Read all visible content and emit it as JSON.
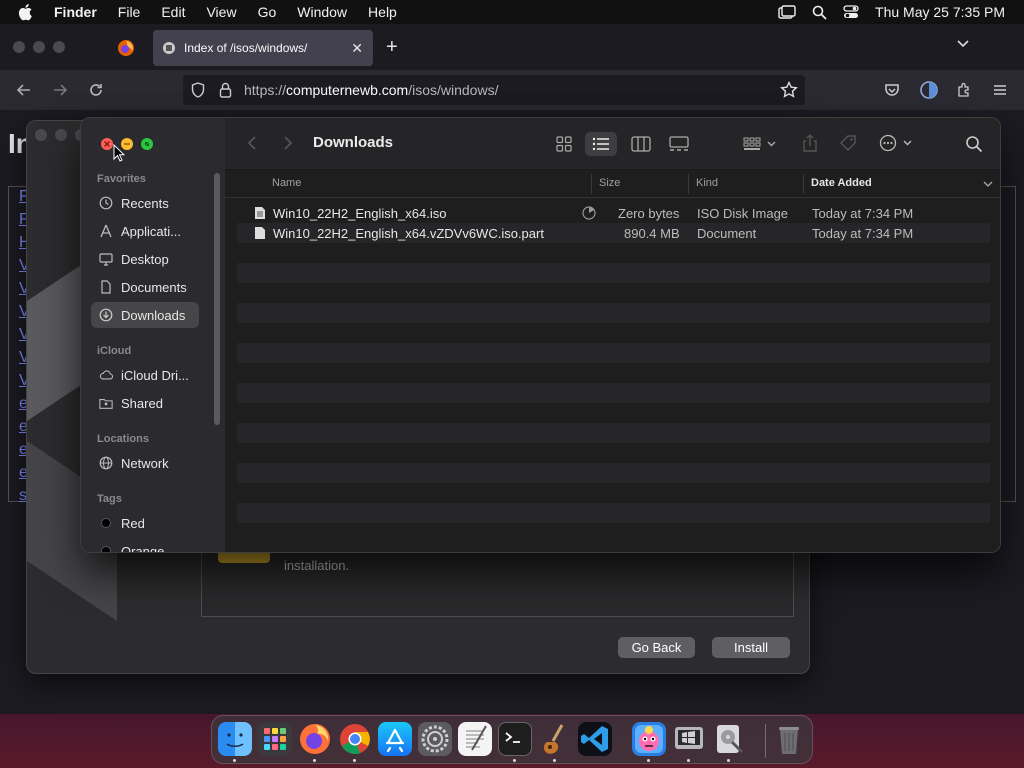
{
  "menubar": {
    "app_name": "Finder",
    "menus": [
      "File",
      "Edit",
      "View",
      "Go",
      "Window",
      "Help"
    ],
    "clock": "Thu May 25  7:35 PM",
    "status_icons": [
      "screen-mirroring-icon",
      "spotlight-search-icon",
      "control-center-icon"
    ]
  },
  "browser": {
    "tab_title": "Index of /isos/windows/",
    "url_prefix": "https://",
    "url_domain": "computernewb.com",
    "url_path": "/isos/windows/",
    "page_title": "In",
    "page_links": [
      "F",
      "F",
      "H",
      "V",
      "V",
      "V",
      "V",
      "V",
      "V",
      "e",
      "e",
      "e",
      "e",
      "s"
    ]
  },
  "installer": {
    "text": "installation.",
    "go_back": "Go Back",
    "install": "Install"
  },
  "finder": {
    "title": "Downloads",
    "sidebar": {
      "favorites_header": "Favorites",
      "favorites": [
        {
          "label": "Recents",
          "icon": "clock-icon"
        },
        {
          "label": "Applicati...",
          "icon": "applications-icon"
        },
        {
          "label": "Desktop",
          "icon": "desktop-icon"
        },
        {
          "label": "Documents",
          "icon": "document-icon"
        },
        {
          "label": "Downloads",
          "icon": "download-icon",
          "selected": true
        }
      ],
      "icloud_header": "iCloud",
      "icloud": [
        {
          "label": "iCloud Dri...",
          "icon": "cloud-icon"
        },
        {
          "label": "Shared",
          "icon": "shared-folder-icon"
        }
      ],
      "locations_header": "Locations",
      "locations": [
        {
          "label": "Network",
          "icon": "globe-icon"
        }
      ],
      "tags_header": "Tags",
      "tags": [
        {
          "label": "Red",
          "color": "#ff3b30"
        },
        {
          "label": "Orange",
          "color": "#ff9500"
        }
      ]
    },
    "columns": {
      "name": "Name",
      "size": "Size",
      "kind": "Kind",
      "date_added": "Date Added"
    },
    "files": [
      {
        "name": "Win10_22H2_English_x64.iso",
        "size": "Zero bytes",
        "kind": "ISO Disk Image",
        "date_added": "Today at 7:34 PM",
        "downloading": true
      },
      {
        "name": "Win10_22H2_English_x64.vZDVv6WC.iso.part",
        "size": "890.4 MB",
        "kind": "Document",
        "date_added": "Today at 7:34 PM",
        "downloading": false
      }
    ]
  },
  "dock": {
    "apps": [
      "finder-icon",
      "launchpad-icon",
      "firefox-icon",
      "chrome-icon",
      "app-store-icon",
      "system-settings-icon",
      "textedit-icon",
      "terminal-icon",
      "instruments-icon",
      "vscode-icon",
      "mascot-app-icon",
      "boot-camp-assistant-icon",
      "disk-utility-icon",
      "trash-icon"
    ]
  },
  "colors": {
    "close": "#ff5f57",
    "minimize": "#febc2e",
    "zoom": "#28c840",
    "sidebar_selected": "#464649",
    "link": "#7f8dff"
  }
}
